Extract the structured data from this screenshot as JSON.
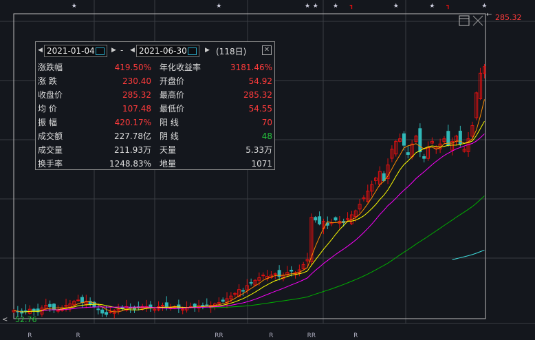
{
  "chart_data": {
    "type": "candlestick",
    "ylim": [
      52.76,
      285.32
    ],
    "low_label": "52.76",
    "high_label": "285.32",
    "close": [
      59,
      58,
      57,
      58,
      60,
      59,
      58,
      61,
      63,
      62,
      60,
      59,
      61,
      63,
      64,
      66,
      67,
      65,
      66,
      64,
      62,
      60,
      57,
      56,
      58,
      59,
      60,
      61,
      62,
      61,
      60,
      61,
      62,
      62,
      61,
      60,
      62,
      63,
      62,
      61,
      62,
      61,
      60,
      61,
      62,
      62,
      63,
      62,
      63,
      63,
      64,
      65,
      66,
      68,
      70,
      72,
      75,
      74,
      78,
      80,
      82,
      84,
      86,
      85,
      86,
      87,
      85,
      86,
      88,
      89,
      88,
      90,
      94,
      98,
      130,
      128,
      125,
      127,
      124,
      126,
      128,
      127,
      126,
      129,
      132,
      135,
      140,
      145,
      150,
      155,
      160,
      165,
      158,
      170,
      182,
      188,
      190,
      185,
      178,
      186,
      192,
      180,
      175,
      183,
      188,
      184,
      186,
      190,
      185,
      188,
      192,
      186,
      182,
      190,
      200,
      225,
      240,
      245
    ],
    "ma_colors": {
      "ma5": "#ff8c00",
      "ma10": "#ffff00",
      "ma20": "#ff00ff",
      "ma60": "#00b000",
      "ma120": "#40e0e0"
    },
    "up_color": "#e01010",
    "down_color": "#30b8b8",
    "top_markers": [
      {
        "x_index": 15,
        "type": "star"
      },
      {
        "x_index": 51,
        "type": "star"
      },
      {
        "x_index": 73,
        "type": "star"
      },
      {
        "x_index": 75,
        "type": "star"
      },
      {
        "x_index": 80,
        "type": "star"
      },
      {
        "x_index": 84,
        "type": "flag"
      },
      {
        "x_index": 95,
        "type": "star"
      },
      {
        "x_index": 104,
        "type": "star"
      },
      {
        "x_index": 108,
        "type": "flag"
      },
      {
        "x_index": 117,
        "type": "star"
      }
    ],
    "bottom_labels": [
      {
        "x_index": 4,
        "text": "R"
      },
      {
        "x_index": 16,
        "text": "R"
      },
      {
        "x_index": 51,
        "text": "RR"
      },
      {
        "x_index": 64,
        "text": "R"
      },
      {
        "x_index": 74,
        "text": "RR"
      },
      {
        "x_index": 85,
        "text": "R"
      }
    ]
  },
  "stats": {
    "start_date": "2021-01-04",
    "end_date": "2021-06-30",
    "separator": "-",
    "days": "(118日)",
    "rows": [
      {
        "l1": "涨跌幅",
        "v1": "419.50%",
        "c1": "red",
        "l2": "年化收益率",
        "v2": "3181.46%",
        "c2": "red"
      },
      {
        "l1": "涨  跌",
        "v1": "230.40",
        "c1": "red",
        "l2": "开盘价",
        "v2": "54.92",
        "c2": "red"
      },
      {
        "l1": "收盘价",
        "v1": "285.32",
        "c1": "red",
        "l2": "最高价",
        "v2": "285.32",
        "c2": "red"
      },
      {
        "l1": "均  价",
        "v1": "107.48",
        "c1": "red",
        "l2": "最低价",
        "v2": "54.55",
        "c2": "red"
      },
      {
        "l1": "振  幅",
        "v1": "420.17%",
        "c1": "red",
        "l2": "阳  线",
        "v2": "70",
        "c2": "red"
      },
      {
        "l1": "成交额",
        "v1": "227.78亿",
        "c1": "",
        "l2": "阴  线",
        "v2": "48",
        "c2": "green"
      },
      {
        "l1": "成交量",
        "v1": "211.93万",
        "c1": "",
        "l2": "天量",
        "v2": "5.33万",
        "c2": ""
      },
      {
        "l1": "换手率",
        "v1": "1248.83%",
        "c1": "",
        "l2": "地量",
        "v2": "1071",
        "c2": ""
      }
    ]
  }
}
